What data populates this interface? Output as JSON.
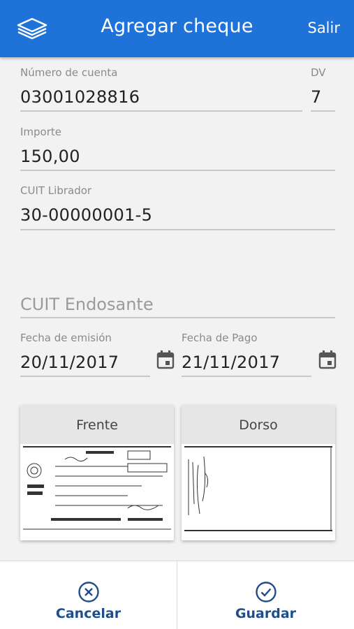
{
  "header": {
    "title": "Agregar cheque",
    "exit_label": "Salir",
    "logo_icon": "stack-layers-icon",
    "background": "#1e72d8"
  },
  "form": {
    "account": {
      "label": "Número de cuenta",
      "value": "03001028816"
    },
    "dv": {
      "label": "DV",
      "value": "7"
    },
    "amount": {
      "label": "Importe",
      "value": "150,00"
    },
    "cuit_drawer": {
      "label": "CUIT Librador",
      "value": "30-00000001-5"
    },
    "cuit_endorser": {
      "placeholder": "CUIT Endosante"
    },
    "issue_date": {
      "label": "Fecha de emisión",
      "value": "20/11/2017"
    },
    "payment_date": {
      "label": "Fecha de Pago",
      "value": "21/11/2017"
    }
  },
  "images": {
    "front": {
      "label": "Frente"
    },
    "back": {
      "label": "Dorso"
    }
  },
  "actions": {
    "cancel": {
      "label": "Cancelar",
      "icon": "close-circle-icon"
    },
    "save": {
      "label": "Guardar",
      "icon": "check-circle-icon"
    },
    "color": "#1e4d8c"
  }
}
